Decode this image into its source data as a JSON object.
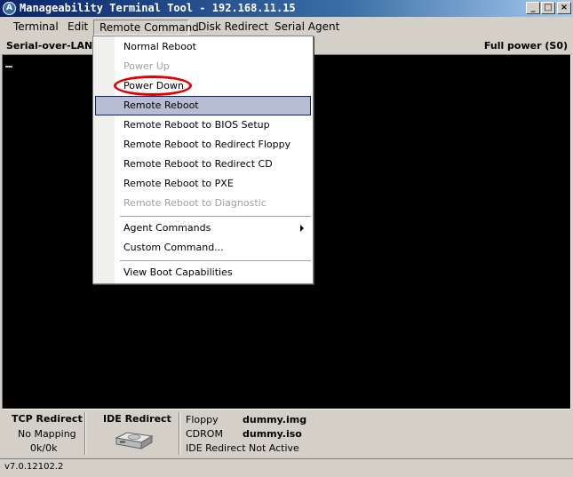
{
  "window": {
    "title": "Manageability Terminal Tool - 192.168.11.15",
    "app_icon_glyph": "A",
    "buttons": {
      "minimize": "_",
      "maximize": "□",
      "close": "×"
    }
  },
  "menubar": {
    "items": [
      "Terminal",
      "Edit",
      "Remote Command",
      "Disk Redirect",
      "Serial Agent"
    ],
    "active": "Remote Command"
  },
  "sol": {
    "label": "Serial-over-LAN -",
    "power_state": "Full power (S0)"
  },
  "remote_command_menu": {
    "items": [
      {
        "label": "Normal Reboot",
        "enabled": true
      },
      {
        "label": "Power Up",
        "enabled": false
      },
      {
        "label": "Power Down",
        "enabled": true,
        "annotated": true
      },
      {
        "label": "Remote Reboot",
        "enabled": true,
        "highlighted": true
      },
      {
        "label": "Remote Reboot to BIOS Setup",
        "enabled": true
      },
      {
        "label": "Remote Reboot to Redirect Floppy",
        "enabled": true
      },
      {
        "label": "Remote Reboot to Redirect CD",
        "enabled": true
      },
      {
        "label": "Remote Reboot to PXE",
        "enabled": true
      },
      {
        "label": "Remote Reboot to Diagnostic",
        "enabled": false
      },
      {
        "label": "Agent Commands",
        "enabled": true,
        "submenu": true
      },
      {
        "label": "Custom Command...",
        "enabled": true
      },
      {
        "label": "View Boot Capabilities",
        "enabled": true
      }
    ]
  },
  "status": {
    "tcp_redirect": {
      "title": "TCP Redirect",
      "mapping": "No Mapping",
      "traffic": "0k/0k"
    },
    "ide_redirect": {
      "title": "IDE Redirect",
      "floppy_label": "Floppy",
      "floppy_value": "dummy.img",
      "cdrom_label": "CDROM",
      "cdrom_value": "dummy.iso",
      "state": "IDE Redirect Not Active"
    },
    "version": "v7.0.12102.2"
  },
  "colors": {
    "annotation": "#e00000",
    "highlight": "#b6bdd2",
    "terminal_bg": "#000000"
  }
}
